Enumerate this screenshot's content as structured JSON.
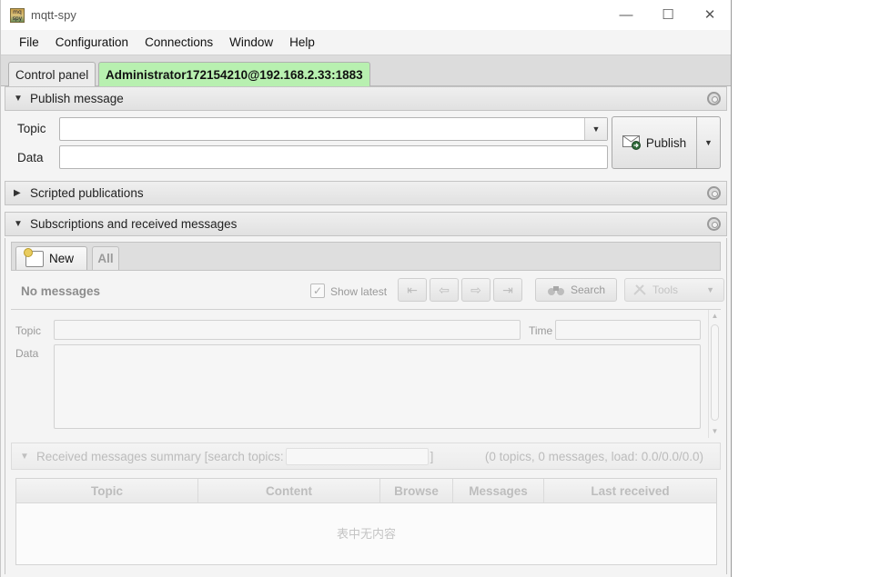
{
  "window": {
    "title": "mqtt-spy",
    "icon_text": "mq spy"
  },
  "window_controls": {
    "minimize": "—",
    "maximize": "☐",
    "close": "✕"
  },
  "menu": [
    "File",
    "Configuration",
    "Connections",
    "Window",
    "Help"
  ],
  "tabs": {
    "control_panel": "Control panel",
    "connection": "Administrator172154210@192.168.2.33:1883",
    "active_color": "#b8f0b0"
  },
  "publish": {
    "header": "Publish message",
    "topic_label": "Topic",
    "data_label": "Data",
    "topic_value": "",
    "data_value": "",
    "button_label": "Publish"
  },
  "scripted": {
    "header": "Scripted publications"
  },
  "subscriptions": {
    "header": "Subscriptions and received messages",
    "new_tab_label": "New",
    "all_tab_label": "All",
    "status": "No messages",
    "show_latest_label": "Show latest",
    "show_latest_checked": true,
    "search_label": "Search",
    "tools_label": "Tools",
    "detail": {
      "topic_label": "Topic",
      "time_label": "Time",
      "data_label": "Data"
    },
    "summary": {
      "prefix": "Received messages summary [search topics:",
      "suffix": "]",
      "stats": "(0 topics, 0 messages, load: 0.0/0.0/0.0)",
      "columns": [
        "Topic",
        "Content",
        "Browse",
        "Messages",
        "Last received"
      ],
      "empty_text": "表中无内容"
    }
  }
}
